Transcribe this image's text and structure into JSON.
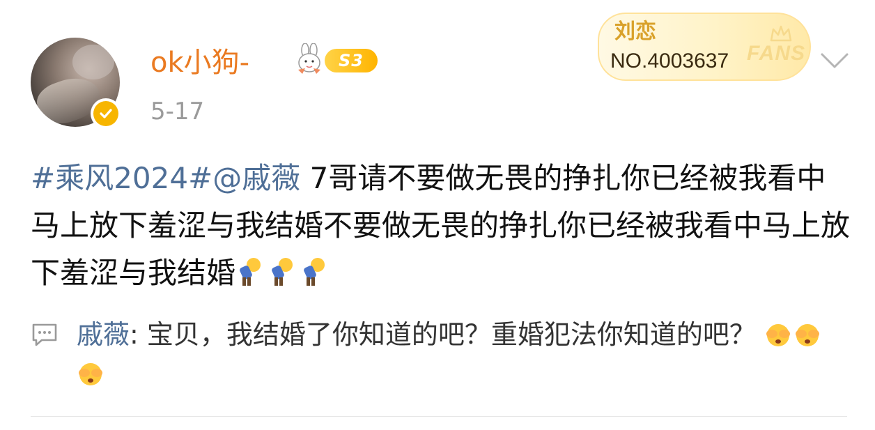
{
  "post": {
    "username": "ok小狗-",
    "level_badge": "S3",
    "timestamp": "5-17",
    "fans_card": {
      "name": "刘恋",
      "number": "NO.4003637",
      "logo": "FANS"
    },
    "body": {
      "topic": "#乘风2024#",
      "mention": "@戚薇",
      "text": " 7哥请不要做无畏的挣扎你已经被我看中马上放下羞涩与我结婚不要做无畏的挣扎你已经被我看中马上放下羞涩与我结婚",
      "emojis": [
        "bowing-emoji",
        "bowing-emoji",
        "bowing-emoji"
      ]
    },
    "comment": {
      "user": "戚薇",
      "separator": ": ",
      "text": "宝贝，我结婚了你知道的吧？重婚犯法你知道的吧？",
      "emojis": [
        "covering-face-emoji",
        "covering-face-emoji",
        "covering-face-emoji"
      ]
    }
  },
  "colors": {
    "username": "#ea7a21",
    "link": "#4f6f97",
    "timestamp": "#9a9a9a",
    "badge": "#ffb400"
  },
  "icons": {
    "avatar": "profile-photo",
    "verified": "verified-badge-icon",
    "mascot": "rabbit-mascot-icon",
    "chevron": "chevron-down-icon",
    "comment": "comment-bubble-icon"
  }
}
